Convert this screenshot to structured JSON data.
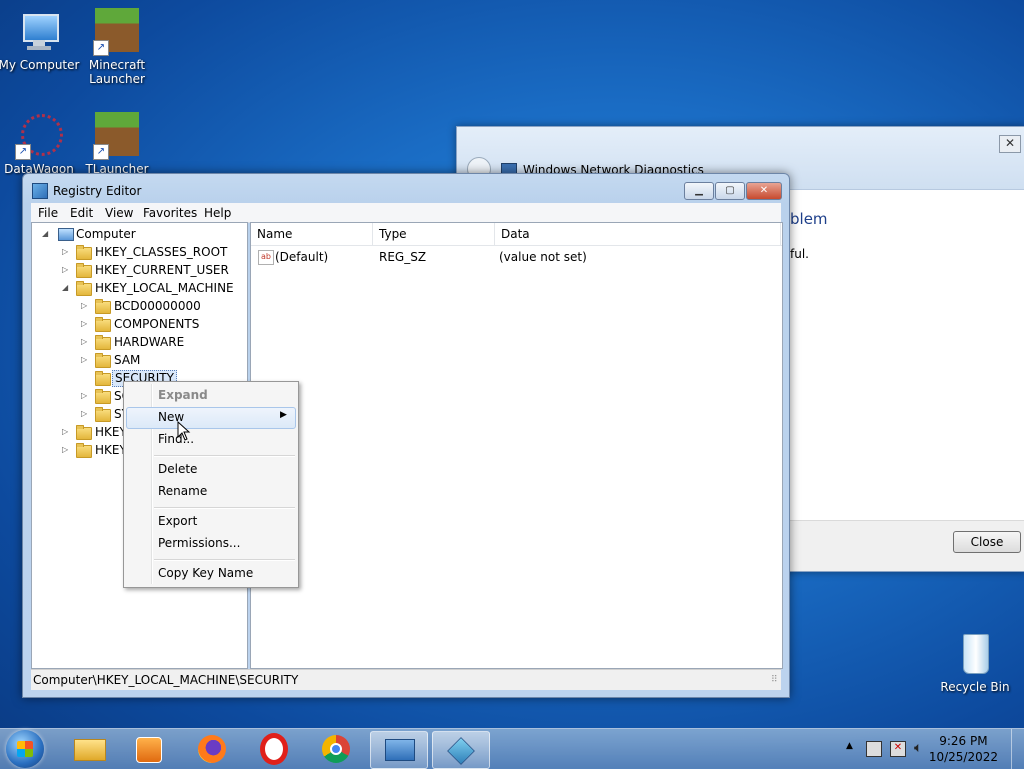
{
  "desktop": {
    "icons": [
      {
        "label": "My Computer"
      },
      {
        "label": "Minecraft Launcher"
      },
      {
        "label": "DataWagon"
      },
      {
        "label": "TLauncher"
      },
      {
        "label": "Recycle Bin"
      }
    ]
  },
  "diagnostics": {
    "title": "Windows Network Diagnostics",
    "heading_fragment": "blem",
    "text_fragment": "ful.",
    "close_label": "Close"
  },
  "regedit": {
    "title": "Registry Editor",
    "menu": [
      "File",
      "Edit",
      "View",
      "Favorites",
      "Help"
    ],
    "tree": {
      "root": "Computer",
      "items": [
        "HKEY_CLASSES_ROOT",
        "HKEY_CURRENT_USER",
        "HKEY_LOCAL_MACHINE",
        "BCD00000000",
        "COMPONENTS",
        "HARDWARE",
        "SAM",
        "SECURITY",
        "SO",
        "SY",
        "HKEY",
        "HKEY"
      ]
    },
    "columns": [
      "Name",
      "Type",
      "Data"
    ],
    "rows": [
      {
        "name": "(Default)",
        "type": "REG_SZ",
        "data": "(value not set)"
      }
    ],
    "status_path": "Computer\\HKEY_LOCAL_MACHINE\\SECURITY"
  },
  "context_menu": {
    "items": [
      "Expand",
      "New",
      "Find...",
      "Delete",
      "Rename",
      "Export",
      "Permissions...",
      "Copy Key Name"
    ]
  },
  "clock": {
    "time": "9:26 PM",
    "date": "10/25/2022"
  }
}
